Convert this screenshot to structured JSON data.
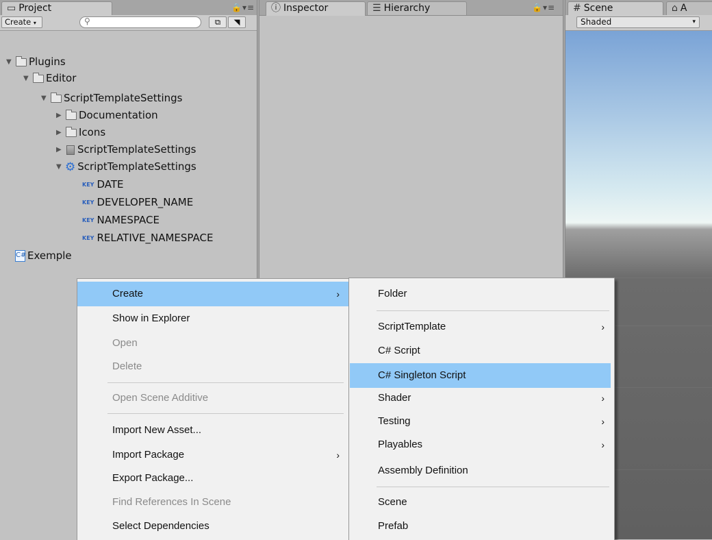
{
  "project_panel": {
    "tab_label": "Project",
    "create_label": "Create",
    "search_placeholder": "",
    "tree": [
      {
        "label": "Plugins"
      },
      {
        "label": "Editor"
      },
      {
        "label": "ScriptTemplateSettings"
      },
      {
        "label": "Documentation"
      },
      {
        "label": "Icons"
      },
      {
        "label": "ScriptTemplateSettings"
      },
      {
        "label": "ScriptTemplateSettings"
      },
      {
        "label": "DATE"
      },
      {
        "label": "DEVELOPER_NAME"
      },
      {
        "label": "NAMESPACE"
      },
      {
        "label": "RELATIVE_NAMESPACE"
      },
      {
        "label": "Exemple"
      }
    ],
    "key_badge": "KEY",
    "cs_badge": "C#"
  },
  "inspector_panel": {
    "tab_inspector": "Inspector",
    "tab_hierarchy": "Hierarchy"
  },
  "scene_panel": {
    "tab_scene": "Scene",
    "tab_next": "A",
    "shading_mode": "Shaded"
  },
  "context_menu": {
    "items": [
      {
        "label": "Create",
        "has_submenu": true,
        "highlighted": true,
        "enabled": true
      },
      {
        "label": "Show in Explorer",
        "enabled": true
      },
      {
        "label": "Open",
        "enabled": false
      },
      {
        "label": "Delete",
        "enabled": false
      },
      {
        "label": "Open Scene Additive",
        "enabled": false
      },
      {
        "label": "Import New Asset...",
        "enabled": true
      },
      {
        "label": "Import Package",
        "has_submenu": true,
        "enabled": true
      },
      {
        "label": "Export Package...",
        "enabled": true
      },
      {
        "label": "Find References In Scene",
        "enabled": false
      },
      {
        "label": "Select Dependencies",
        "enabled": true
      }
    ]
  },
  "create_submenu": {
    "items": [
      {
        "label": "Folder"
      },
      {
        "label": "ScriptTemplate",
        "has_submenu": true
      },
      {
        "label": "C# Script"
      },
      {
        "label": "C# Singleton Script",
        "highlighted": true
      },
      {
        "label": "Shader",
        "has_submenu": true
      },
      {
        "label": "Testing",
        "has_submenu": true
      },
      {
        "label": "Playables",
        "has_submenu": true
      },
      {
        "label": "Assembly Definition"
      },
      {
        "label": "Scene"
      },
      {
        "label": "Prefab"
      }
    ]
  },
  "colors": {
    "highlight": "#91c9f7",
    "panel_bg": "#c2c2c2",
    "menu_bg": "#f1f1f1"
  }
}
